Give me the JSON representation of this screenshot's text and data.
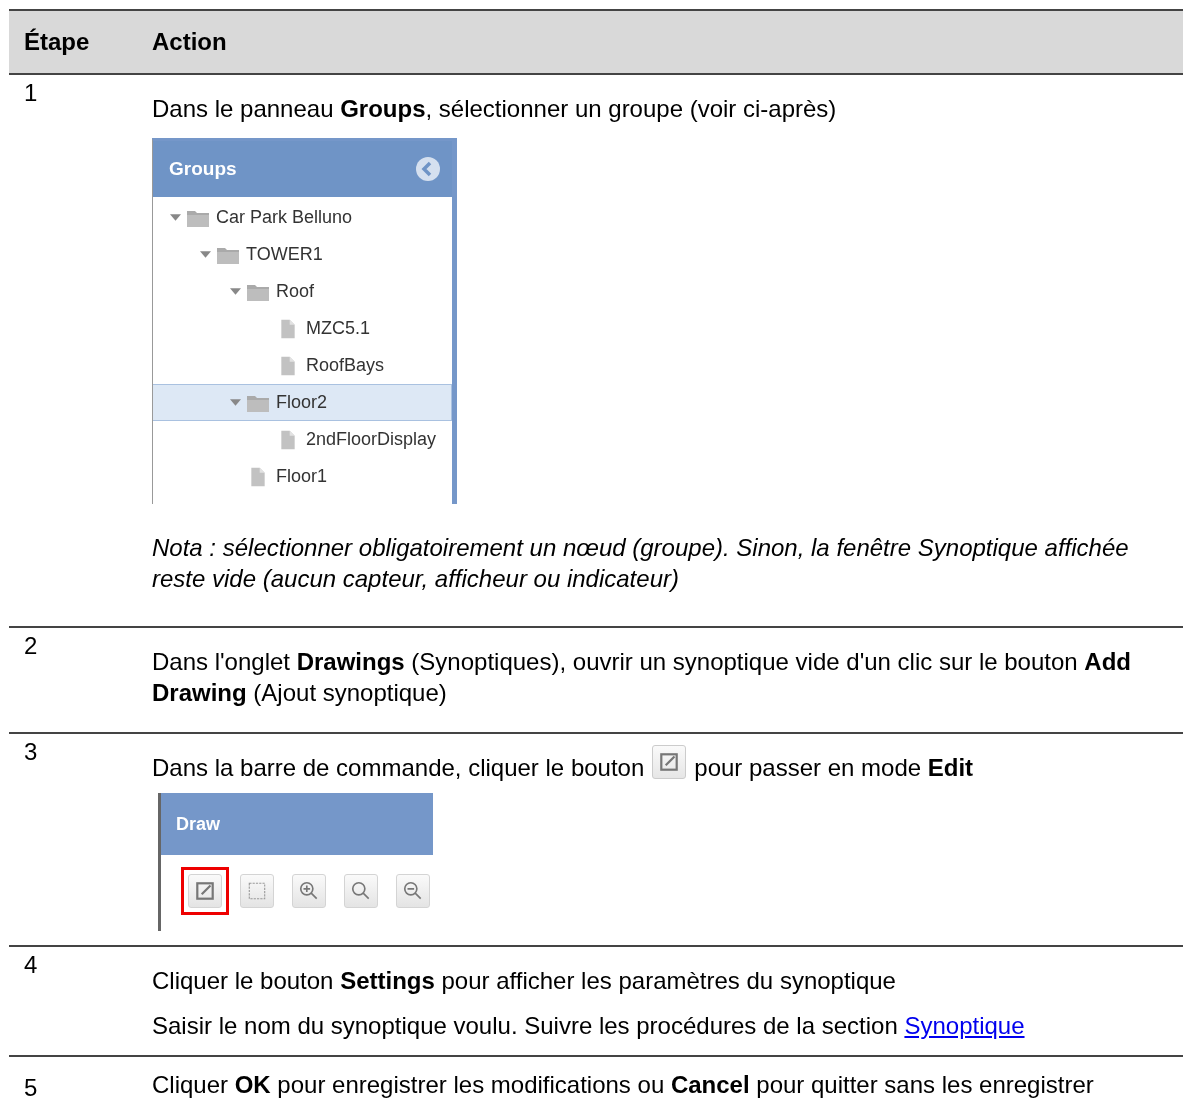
{
  "table": {
    "columns": [
      "Étape",
      "Action"
    ],
    "rows": [
      {
        "step": "1",
        "blocks": [
          {
            "kind": "text",
            "text": "Dans le panneau **Groups**, sélectionner un groupe (voir ci-après)"
          },
          {
            "kind": "tree_panel",
            "title": "Groups",
            "tree": [
              {
                "label": "Car Park Belluno",
                "kind": "folder",
                "expanded": true,
                "selected": false,
                "children": [
                  {
                    "label": "TOWER1",
                    "kind": "folder",
                    "expanded": true,
                    "selected": false,
                    "children": [
                      {
                        "label": "Roof",
                        "kind": "folder",
                        "expanded": true,
                        "selected": false,
                        "children": [
                          {
                            "label": "MZC5.1",
                            "kind": "file",
                            "selected": false
                          },
                          {
                            "label": "RoofBays",
                            "kind": "file",
                            "selected": false
                          }
                        ]
                      },
                      {
                        "label": "Floor2",
                        "kind": "folder",
                        "expanded": true,
                        "selected": true,
                        "children": [
                          {
                            "label": "2ndFloorDisplay",
                            "kind": "file",
                            "selected": false
                          }
                        ]
                      },
                      {
                        "label": "Floor1",
                        "kind": "file",
                        "selected": false
                      }
                    ]
                  }
                ]
              }
            ]
          },
          {
            "kind": "note",
            "text": "Nota : sélectionner obligatoirement un nœud (groupe). Sinon, la fenêtre Synoptique affichée reste vide (aucun capteur, afficheur ou indicateur)"
          }
        ]
      },
      {
        "step": "2",
        "blocks": [
          {
            "kind": "text",
            "text": "Dans l'onglet **Drawings** (Synoptiques), ouvrir un synoptique vide d'un clic sur le bouton **Add Drawing** (Ajout synoptique)"
          }
        ]
      },
      {
        "step": "3",
        "blocks": [
          {
            "kind": "text_icon",
            "before": "Dans la barre de commande, cliquer le bouton",
            "after": "pour passer en mode **Edit**"
          },
          {
            "kind": "toolbar",
            "title": "Draw",
            "buttons": [
              {
                "kind": "edit",
                "highlighted": true
              },
              {
                "kind": "select",
                "highlighted": false
              },
              {
                "kind": "zoom_in",
                "highlighted": false
              },
              {
                "kind": "zoom",
                "highlighted": false
              },
              {
                "kind": "zoom_out",
                "highlighted": false
              }
            ]
          }
        ]
      },
      {
        "step": "4",
        "blocks": [
          {
            "kind": "text",
            "text": "Cliquer le bouton **Settings** pour afficher les paramètres du synoptique"
          },
          {
            "kind": "link_text",
            "text": "Saisir le nom du synoptique voulu. Suivre les procédures de la section",
            "link": "Synoptique"
          }
        ]
      },
      {
        "step": "5",
        "blocks": [
          {
            "kind": "text",
            "text": "Cliquer **OK** pour enregistrer les modifications ou **Cancel** pour quitter sans les enregistrer"
          }
        ]
      }
    ]
  }
}
